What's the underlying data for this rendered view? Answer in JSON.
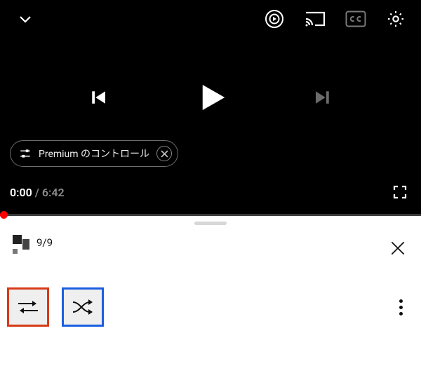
{
  "player": {
    "premium_chip_label": "Premium のコントロール",
    "time_current": "0:00",
    "time_separator": " / ",
    "time_duration": "6:42"
  },
  "sheet": {
    "index_label": "9/9"
  }
}
